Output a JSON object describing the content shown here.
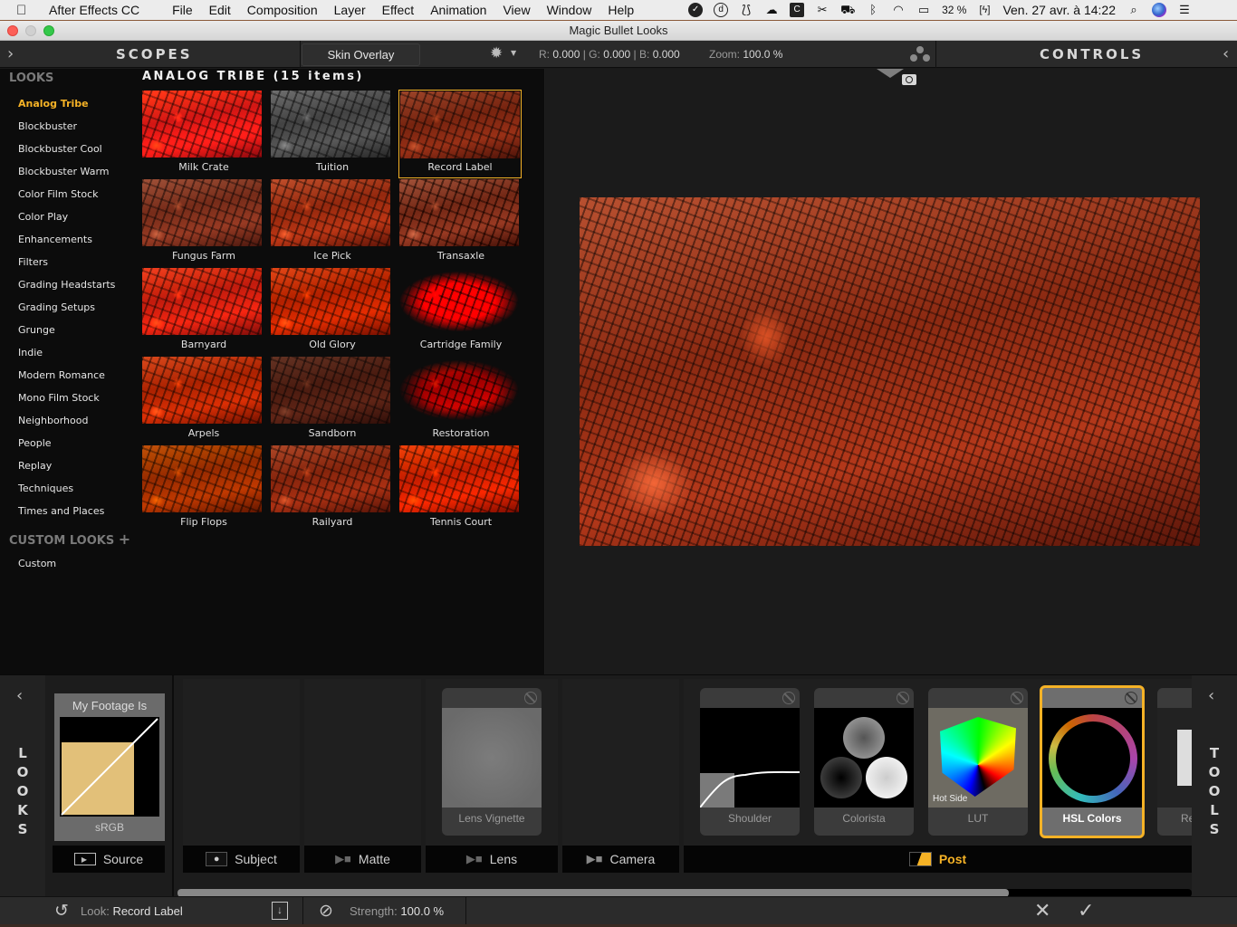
{
  "menubar": {
    "apple_icon": "apple-logo",
    "app_name": "After Effects CC",
    "menus": [
      "File",
      "Edit",
      "Composition",
      "Layer",
      "Effect",
      "Animation",
      "View",
      "Window",
      "Help"
    ],
    "battery": "32 %",
    "datetime": "Ven. 27 avr. à 14:22"
  },
  "window": {
    "title": "Magic Bullet Looks"
  },
  "topbar": {
    "scopes_label": "SCOPES",
    "skin_overlay_label": "Skin Overlay",
    "readout": {
      "r_label": "R:",
      "r": "0.000",
      "g_label": "G:",
      "g": "0.000",
      "b_label": "B:",
      "b": "0.000",
      "zoom_label": "Zoom:",
      "zoom": "100.0 %"
    },
    "controls_label": "CONTROLS"
  },
  "looks_sidebar": {
    "title": "LOOKS",
    "categories": [
      "Analog Tribe",
      "Blockbuster",
      "Blockbuster Cool",
      "Blockbuster Warm",
      "Color Film Stock",
      "Color Play",
      "Enhancements",
      "Filters",
      "Grading Headstarts",
      "Grading Setups",
      "Grunge",
      "Indie",
      "Modern Romance",
      "Mono Film Stock",
      "Neighborhood",
      "People",
      "Replay",
      "Techniques",
      "Times and Places"
    ],
    "active_category": "Analog Tribe",
    "custom_title": "CUSTOM LOOKS",
    "custom_items": [
      "Custom"
    ]
  },
  "looks_grid": {
    "title": "ANALOG TRIBE (15 items)",
    "selected": "Record Label",
    "items": [
      "Milk Crate",
      "Tuition",
      "Record Label",
      "Fungus Farm",
      "Ice Pick",
      "Transaxle",
      "Barnyard",
      "Old Glory",
      "Cartridge Family",
      "Arpels",
      "Sandborn",
      "Restoration",
      "Flip Flops",
      "Railyard",
      "Tennis Court"
    ]
  },
  "bottom": {
    "left_tab": "LOOKS",
    "right_tab": "TOOLS",
    "footage": {
      "title": "My Footage Is",
      "value": "sRGB"
    },
    "sections": [
      "Source",
      "Subject",
      "Matte",
      "Lens",
      "Camera",
      "Post"
    ],
    "active_section": "Post",
    "tools": [
      {
        "name": "Lens Vignette"
      },
      {
        "name": "Shoulder"
      },
      {
        "name": "Colorista"
      },
      {
        "name": "LUT",
        "sublabel": "Hot Side"
      },
      {
        "name": "HSL Colors"
      },
      {
        "name": "Re"
      }
    ],
    "selected_tool": "HSL Colors",
    "scroll_fraction": 0.82
  },
  "statusbar": {
    "look_label": "Look:",
    "look_value": "Record Label",
    "strength_label": "Strength:",
    "strength_value": "100.0 %"
  },
  "colors": {
    "accent": "#f5b226",
    "panel": "#1c1c1c",
    "sidebar": "#0c0c0c"
  }
}
